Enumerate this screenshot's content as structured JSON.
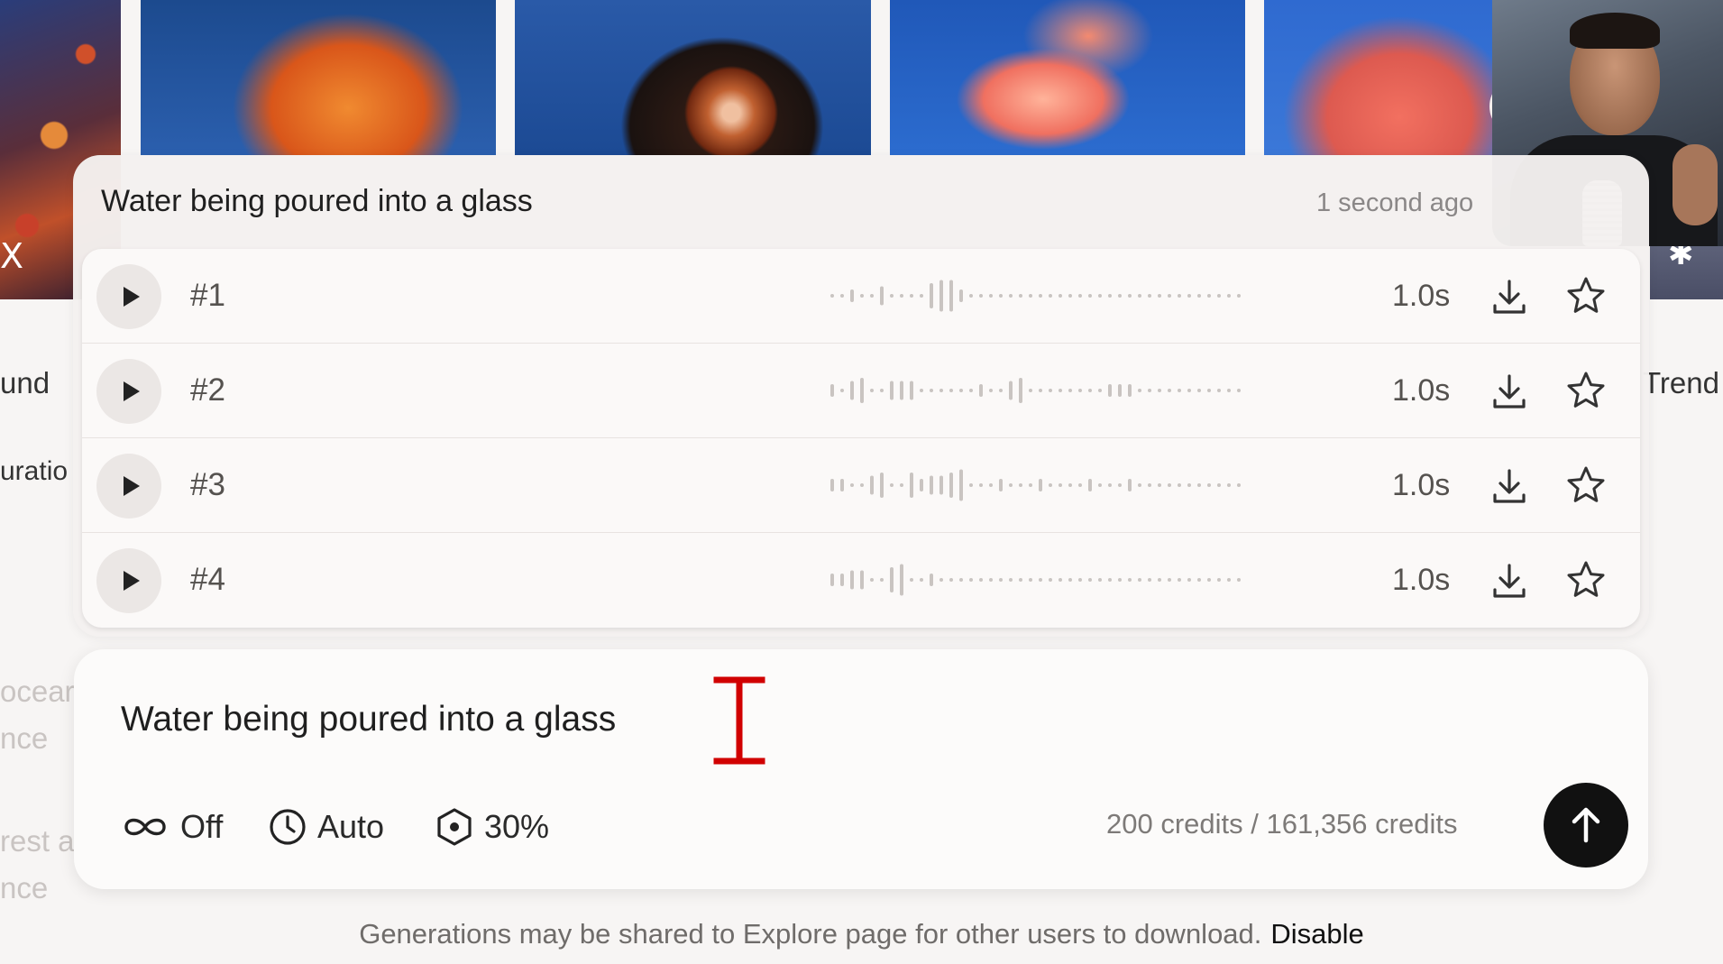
{
  "generation": {
    "title": "Water being poured into a glass",
    "time": "1 second ago",
    "results": [
      {
        "label": "#1",
        "duration": "1.0s",
        "wave": [
          1,
          1,
          2,
          1,
          1,
          3,
          1,
          1,
          1,
          1,
          4,
          5,
          5,
          2,
          1,
          1,
          1,
          1,
          1,
          1,
          1,
          1,
          1,
          1,
          1,
          1,
          1,
          1,
          1,
          1,
          1,
          1,
          1,
          1,
          1,
          1,
          1,
          1,
          1,
          1,
          1,
          1
        ]
      },
      {
        "label": "#2",
        "duration": "1.0s",
        "wave": [
          2,
          1,
          3,
          4,
          1,
          1,
          3,
          3,
          3,
          1,
          1,
          1,
          1,
          1,
          1,
          2,
          1,
          1,
          3,
          4,
          1,
          1,
          1,
          1,
          1,
          1,
          1,
          1,
          2,
          2,
          2,
          1,
          1,
          1,
          1,
          1,
          1,
          1,
          1,
          1,
          1,
          1
        ]
      },
      {
        "label": "#3",
        "duration": "1.0s",
        "wave": [
          2,
          2,
          1,
          1,
          3,
          4,
          1,
          1,
          4,
          2,
          3,
          3,
          4,
          5,
          1,
          1,
          1,
          2,
          1,
          1,
          1,
          2,
          1,
          1,
          1,
          1,
          2,
          1,
          1,
          1,
          2,
          1,
          1,
          1,
          1,
          1,
          1,
          1,
          1,
          1,
          1,
          1
        ]
      },
      {
        "label": "#4",
        "duration": "1.0s",
        "wave": [
          2,
          2,
          3,
          3,
          1,
          1,
          4,
          5,
          1,
          1,
          2,
          1,
          1,
          1,
          1,
          1,
          1,
          1,
          1,
          1,
          1,
          1,
          1,
          1,
          1,
          1,
          1,
          1,
          1,
          1,
          1,
          1,
          1,
          1,
          1,
          1,
          1,
          1,
          1,
          1,
          1,
          1
        ]
      }
    ]
  },
  "composer": {
    "prompt_value": "Water being poured into a glass",
    "loop_label": "Off",
    "duration_label": "Auto",
    "influence_label": "30%",
    "credits": "200 credits / 161,356 credits"
  },
  "footer": {
    "notice": "Generations may be shared to Explore page for other users to download.",
    "disable_label": "Disable"
  },
  "background": {
    "left_fragments": [
      "und",
      "uratio",
      "ocear",
      "nce",
      "rest a",
      "nce"
    ],
    "right_fragment": "Trend",
    "x_glyph": "X"
  },
  "icons": {
    "play": "play-icon",
    "download": "download-icon",
    "star": "star-icon",
    "loop": "infinity-icon",
    "duration": "clock-icon",
    "influence": "hexagon-icon",
    "send": "arrow-up-icon"
  },
  "colors": {
    "send_button": "#111111",
    "cursor": "#d10000",
    "card_bg": "#f4f1f0"
  }
}
